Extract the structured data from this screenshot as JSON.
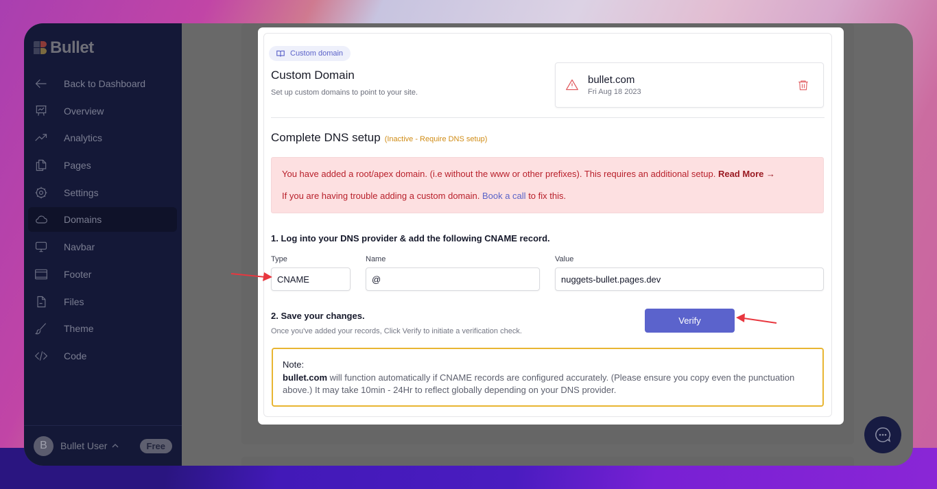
{
  "app": {
    "brand": "Bullet"
  },
  "sidebar": {
    "items": [
      {
        "label": "Back to Dashboard",
        "icon": "arrow-left-icon"
      },
      {
        "label": "Overview",
        "icon": "presentation-chart-icon"
      },
      {
        "label": "Analytics",
        "icon": "trending-up-icon"
      },
      {
        "label": "Pages",
        "icon": "documents-icon"
      },
      {
        "label": "Settings",
        "icon": "gear-icon"
      },
      {
        "label": "Domains",
        "icon": "cloud-icon",
        "active": true
      },
      {
        "label": "Navbar",
        "icon": "monitor-icon"
      },
      {
        "label": "Footer",
        "icon": "footer-layout-icon"
      },
      {
        "label": "Files",
        "icon": "file-icon"
      },
      {
        "label": "Theme",
        "icon": "brush-icon"
      },
      {
        "label": "Code",
        "icon": "code-icon"
      }
    ],
    "user": {
      "initial": "B",
      "name": "Bullet User",
      "plan": "Free"
    }
  },
  "modal": {
    "pill_label": "Custom domain",
    "title": "Custom Domain",
    "subtitle": "Set up custom domains to point to your site.",
    "domain": {
      "name": "bullet.com",
      "date": "Fri Aug 18 2023"
    },
    "dns": {
      "title": "Complete DNS setup",
      "status": "(Inactive - Require DNS setup)"
    },
    "alert": {
      "line1_text": "You have added a root/apex domain. (i.e without the www or other prefixes). This requires an additional setup.",
      "line1_link": "Read More →",
      "line2_prefix": "If you are having trouble adding a custom domain.",
      "line2_link": "Book a call",
      "line2_suffix": "to fix this."
    },
    "step1": "1. Log into your DNS provider & add the following CNAME record.",
    "fields": {
      "type_label": "Type",
      "type_value": "CNAME",
      "name_label": "Name",
      "name_value": "@",
      "value_label": "Value",
      "value_value": "nuggets-bullet.pages.dev"
    },
    "step2": "2. Save your changes.",
    "step2_sub": "Once you've added your records, Click Verify to initiate a verification check.",
    "verify_label": "Verify",
    "note": {
      "title": "Note:",
      "domain": "bullet.com",
      "body": "will function automatically if CNAME records are configured accurately. (Please ensure you copy even the punctuation above.) It may take 10min - 24Hr to reflect globally depending on your DNS provider."
    }
  },
  "colors": {
    "accent": "#5b63cc",
    "sidebar_bg": "#141837",
    "alert_bg": "#fde0e1",
    "alert_text": "#b8202b",
    "warning": "#e8b531",
    "annotation_arrow": "#e8373f"
  }
}
